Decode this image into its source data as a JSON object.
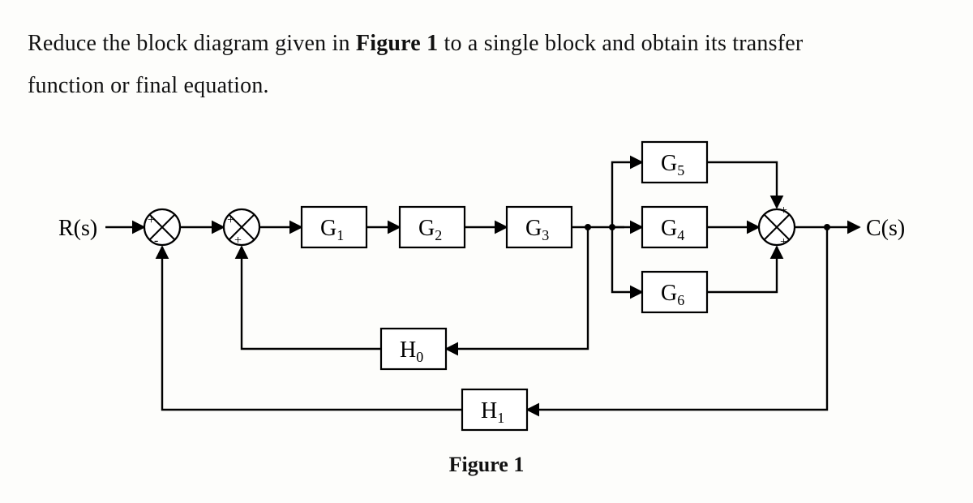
{
  "problem": {
    "line1_pre": "Reduce the block diagram given in ",
    "figure_ref": "Figure 1",
    "line1_post": " to a single block and obtain its transfer",
    "line2": "function or final equation."
  },
  "caption": "Figure 1",
  "io": {
    "input": "R(s)",
    "output": "C(s)"
  },
  "blocks": {
    "G1": "G",
    "G1_sub": "1",
    "G2": "G",
    "G2_sub": "2",
    "G3": "G",
    "G3_sub": "3",
    "G4": "G",
    "G4_sub": "4",
    "G5": "G",
    "G5_sub": "5",
    "G6": "G",
    "G6_sub": "6",
    "H0": "H",
    "H0_sub": "0",
    "H1": "H",
    "H1_sub": "1"
  },
  "summing": {
    "s1": {
      "left": "+",
      "bottom": "-"
    },
    "s2": {
      "left": "+",
      "bottom": "+"
    },
    "s3": {
      "top": "+",
      "bottom": "+"
    }
  },
  "chart_data": {
    "type": "block-diagram",
    "note": "Control-system block diagram; not a data chart.",
    "input": "R(s)",
    "output": "C(s)",
    "forward_path": [
      "sum1",
      "sum2",
      "G1",
      "G2",
      "G3",
      "parallel(G5,G4,G6)",
      "sum3",
      "C(s)"
    ],
    "parallel_branch_after_G3": [
      "G5",
      "G4",
      "G6"
    ],
    "feedback_loops": [
      {
        "from_after": "G3",
        "through": "H0",
        "into": "sum2",
        "sign": "+"
      },
      {
        "from": "C(s)",
        "through": "H1",
        "into": "sum1",
        "sign": "-"
      }
    ]
  }
}
